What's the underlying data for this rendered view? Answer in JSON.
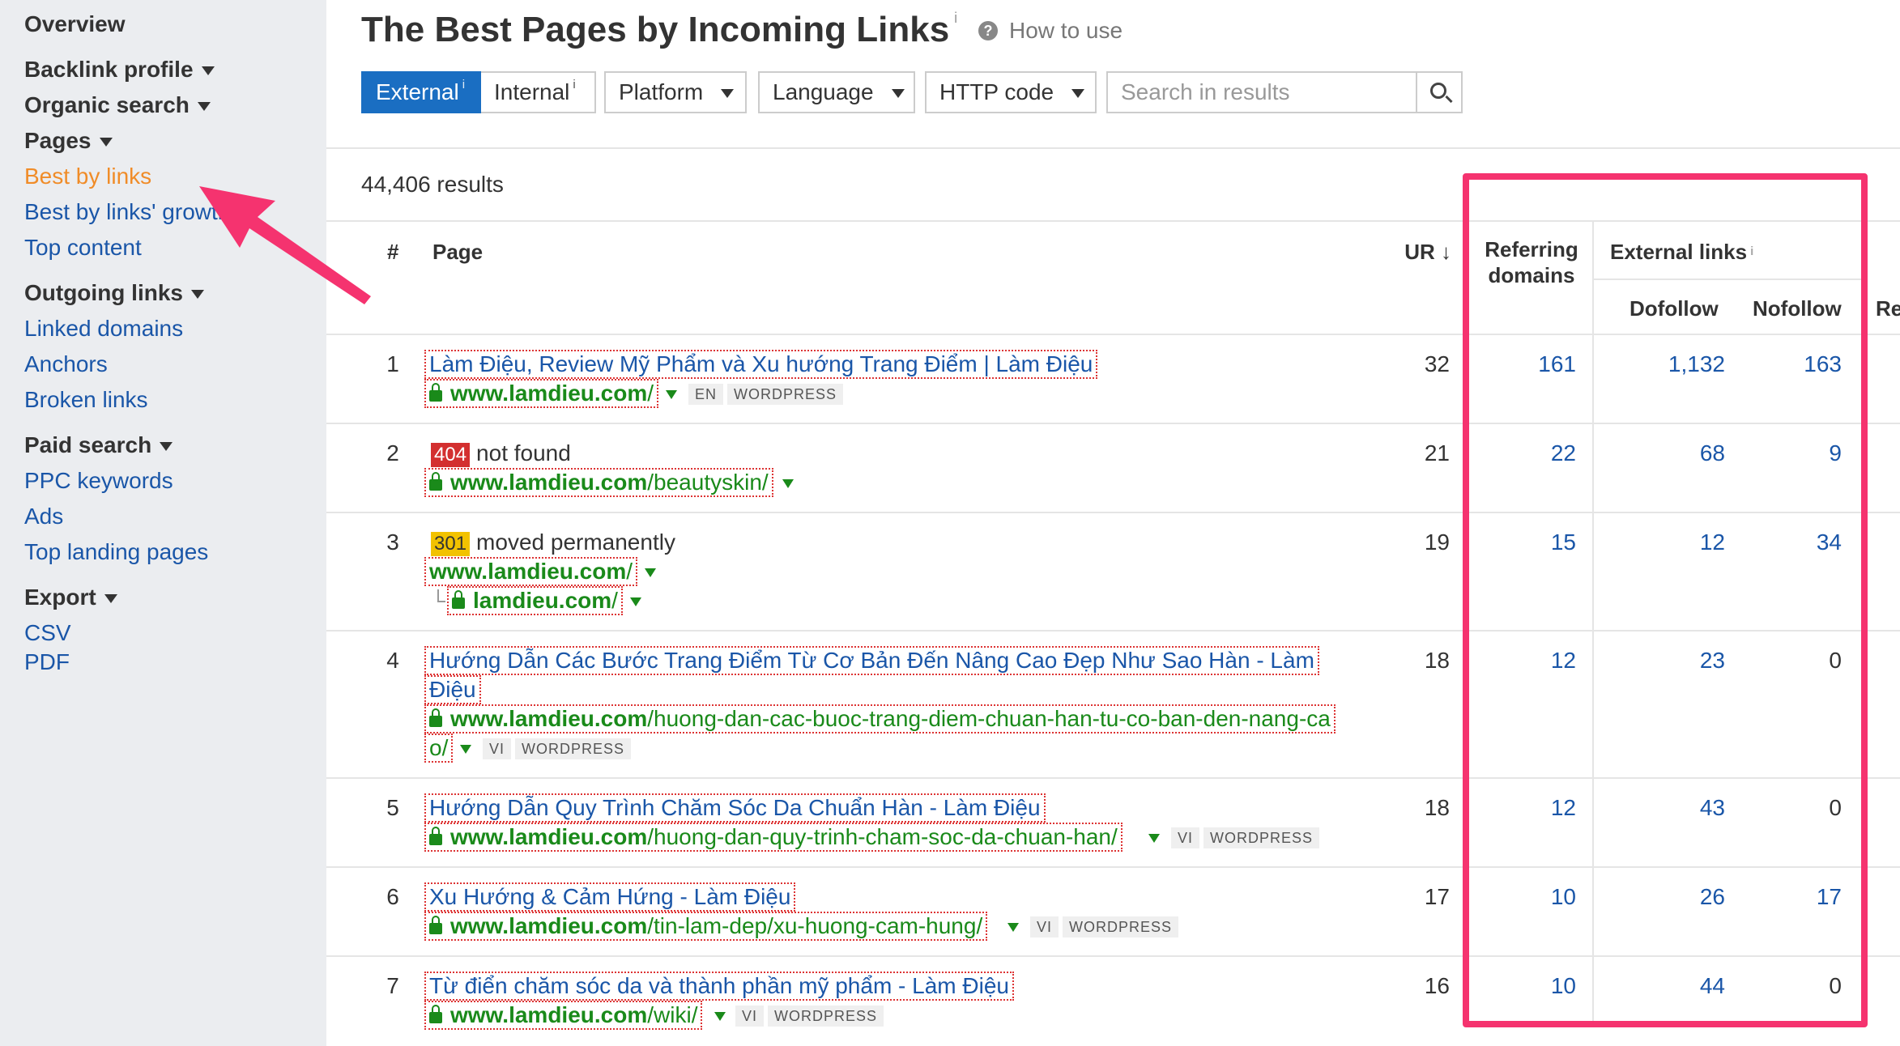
{
  "sidebar": {
    "overview": "Overview",
    "backlink_profile": "Backlink profile",
    "organic_search": "Organic search",
    "pages": "Pages",
    "best_by_links": "Best by links",
    "best_by_links_growth": "Best by links' growth",
    "top_content": "Top content",
    "outgoing_links": "Outgoing links",
    "linked_domains": "Linked domains",
    "anchors": "Anchors",
    "broken_links": "Broken links",
    "paid_search": "Paid search",
    "ppc_keywords": "PPC keywords",
    "ads": "Ads",
    "top_landing_pages": "Top landing pages",
    "export": "Export",
    "csv": "CSV",
    "pdf": "PDF"
  },
  "header": {
    "title": "The Best Pages by Incoming Links",
    "title_info": "i",
    "how_to_use": "How to use"
  },
  "filters": {
    "external": "External",
    "internal": "Internal",
    "info": "i",
    "platform": "Platform",
    "language": "Language",
    "http_code": "HTTP code",
    "search_placeholder": "Search in results"
  },
  "results_count": "44,406 results",
  "table": {
    "headers": {
      "num": "#",
      "page": "Page",
      "ur": "UR ↓",
      "referring": "Referring",
      "domains": "domains",
      "external_links": "External links",
      "external_info": "i",
      "dofollow": "Dofollow",
      "nofollow": "Nofollow",
      "re": "Re"
    },
    "rows": [
      {
        "num": "1",
        "title": "Làm Điệu, Review Mỹ Phẩm và Xu hướng Trang Điểm | Làm Điệu",
        "url_domain": "www.lamdieu.com",
        "url_path": "/",
        "lang": "EN",
        "platform": "WORDPRESS",
        "ur": "32",
        "referring": "161",
        "dofollow": "1,132",
        "nofollow": "163"
      },
      {
        "num": "2",
        "status_code": "404",
        "status_text": "not found",
        "url_domain": "www.lamdieu.com",
        "url_path": "/beautyskin/",
        "ur": "21",
        "referring": "22",
        "dofollow": "68",
        "nofollow": "9"
      },
      {
        "num": "3",
        "status_code": "301",
        "status_text": "moved permanently",
        "url_domain": "www.lamdieu.com",
        "url_path": "/",
        "redirect_domain": "lamdieu.com",
        "redirect_path": "/",
        "ur": "19",
        "referring": "15",
        "dofollow": "12",
        "nofollow": "34"
      },
      {
        "num": "4",
        "title_line1": "Hướng Dẫn Các Bước Trang Điểm Từ Cơ Bản Đến Nâng Cao Đẹp Như Sao Hàn - Làm",
        "title_line2": "Điệu",
        "url_domain": "www.lamdieu.com",
        "url_path_line1": "/huong-dan-cac-buoc-trang-diem-chuan-han-tu-co-ban-den-nang-ca",
        "url_path_line2": "o/",
        "lang": "VI",
        "platform": "WORDPRESS",
        "ur": "18",
        "referring": "12",
        "dofollow": "23",
        "nofollow": "0"
      },
      {
        "num": "5",
        "title": "Hướng Dẫn Quy Trình Chăm Sóc Da Chuẩn Hàn - Làm Điệu",
        "url_domain": "www.lamdieu.com",
        "url_path": "/huong-dan-quy-trinh-cham-soc-da-chuan-han/",
        "lang": "VI",
        "platform": "WORDPRESS",
        "ur": "18",
        "referring": "12",
        "dofollow": "43",
        "nofollow": "0"
      },
      {
        "num": "6",
        "title": "Xu Hướng & Cảm Hứng - Làm Điệu",
        "url_domain": "www.lamdieu.com",
        "url_path": "/tin-lam-dep/xu-huong-cam-hung/",
        "lang": "VI",
        "platform": "WORDPRESS",
        "ur": "17",
        "referring": "10",
        "dofollow": "26",
        "nofollow": "17"
      },
      {
        "num": "7",
        "title": "Từ điển chăm sóc da và thành phần mỹ phẩm - Làm Điệu",
        "url_domain": "www.lamdieu.com",
        "url_path": "/wiki/",
        "lang": "VI",
        "platform": "WORDPRESS",
        "ur": "16",
        "referring": "10",
        "dofollow": "44",
        "nofollow": "0"
      }
    ]
  },
  "colors": {
    "accent_blue": "#1a6ec2",
    "link_blue": "#1a56a8",
    "url_green": "#1a8a1a",
    "active_orange": "#f08c28",
    "highlight_pink": "#f5336f",
    "status_404": "#d32f2f",
    "status_301": "#f2c200"
  },
  "icons": {
    "help": "question-circle-icon",
    "search": "search-icon",
    "lock": "lock-icon",
    "annotation": "pink-arrow-annotation"
  }
}
